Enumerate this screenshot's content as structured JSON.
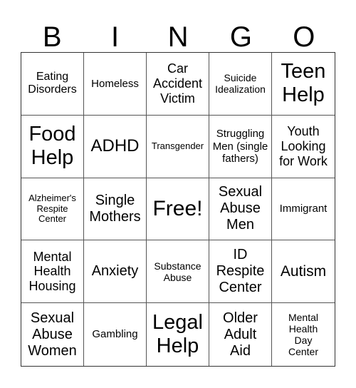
{
  "header": {
    "letters": [
      "B",
      "I",
      "N",
      "G",
      "O"
    ]
  },
  "board": {
    "cells": [
      "Eating Disorders",
      "Homeless",
      "Car Accident Victim",
      "Suicide Idealization",
      "Teen Help",
      "Food Help",
      "ADHD",
      "Transgender",
      "Struggling Men (single fathers)",
      "Youth Looking for Work",
      "Alzheimer's Respite Center",
      "Single Mothers",
      "Free!",
      "Sexual Abuse Men",
      "Immigrant",
      "Mental Health Housing",
      "Anxiety",
      "Substance Abuse",
      "ID Respite Center",
      "Autism",
      "Sexual Abuse Women",
      "Gambling",
      "Legal Help",
      "Older Adult Aid",
      "Mental Health Day Center"
    ],
    "free_space_index": 12
  }
}
